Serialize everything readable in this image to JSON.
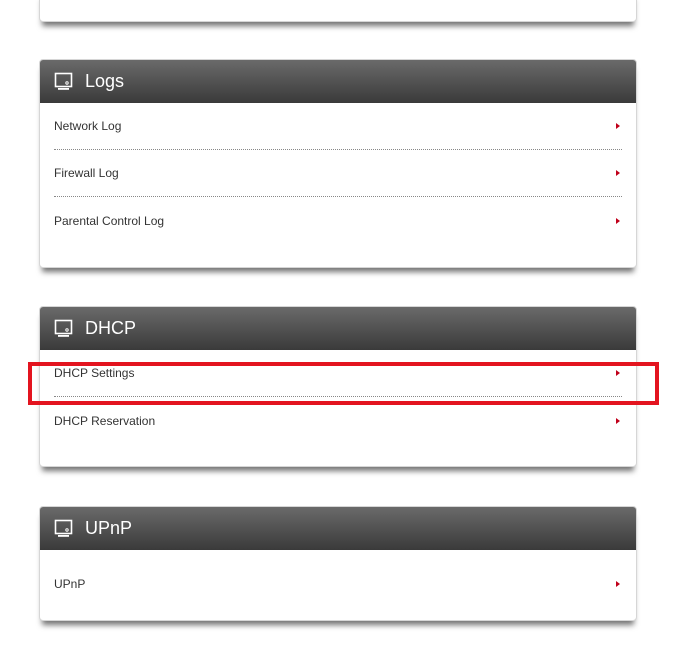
{
  "panels": {
    "logs": {
      "title": "Logs",
      "items": [
        {
          "label": "Network Log"
        },
        {
          "label": "Firewall Log"
        },
        {
          "label": "Parental Control Log"
        }
      ]
    },
    "dhcp": {
      "title": "DHCP",
      "items": [
        {
          "label": "DHCP Settings"
        },
        {
          "label": "DHCP Reservation"
        }
      ]
    },
    "upnp": {
      "title": "UPnP",
      "items": [
        {
          "label": "UPnP"
        }
      ]
    }
  },
  "icons": {
    "panel_icon": "monitor-icon",
    "row_arrow": "arrow-right-icon"
  },
  "colors": {
    "header_dark": "#3a3a3a",
    "header_light": "#6a6a6a",
    "arrow": "#c0001a",
    "highlight": "#e3141f"
  }
}
